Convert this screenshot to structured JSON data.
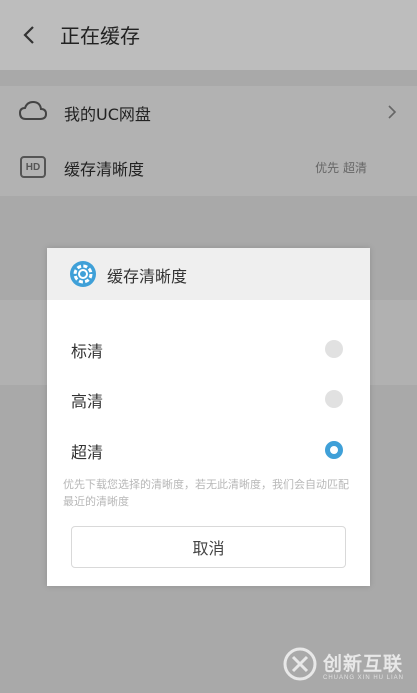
{
  "header": {
    "title": "正在缓存"
  },
  "list": {
    "items": [
      {
        "label": "我的UC网盘"
      },
      {
        "label": "缓存清晰度",
        "value": "优先 超清"
      }
    ]
  },
  "dialog": {
    "title": "缓存清晰度",
    "options": [
      {
        "label": "标清",
        "selected": false
      },
      {
        "label": "高清",
        "selected": false
      },
      {
        "label": "超清",
        "selected": true
      }
    ],
    "note": "优先下载您选择的清晰度，若无此清晰度，我们会自动匹配最近的清晰度",
    "cancel_label": "取消"
  },
  "colors": {
    "accent": "#3fa0d8",
    "overlay": "#a9a9a9"
  },
  "watermark": {
    "text": "创新互联",
    "sub": "CHUANG XIN HU LIAN"
  }
}
